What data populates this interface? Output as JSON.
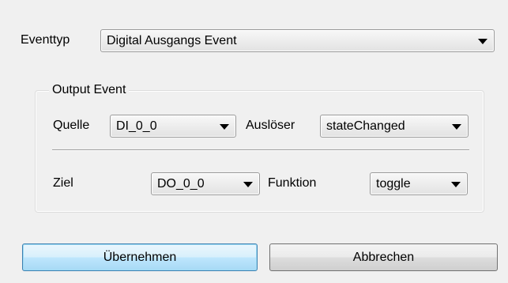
{
  "event_type": {
    "label": "Eventtyp",
    "value": "Digital Ausgangs Event"
  },
  "output_event": {
    "title": "Output Event",
    "source": {
      "label": "Quelle",
      "value": "DI_0_0"
    },
    "trigger": {
      "label": "Auslöser",
      "value": "stateChanged"
    },
    "target": {
      "label": "Ziel",
      "value": "DO_0_0"
    },
    "function": {
      "label": "Funktion",
      "value": "toggle"
    }
  },
  "buttons": {
    "apply": "Übernehmen",
    "cancel": "Abbrechen"
  },
  "colors": {
    "window_background": "#f0f0f0",
    "default_button_border": "#3c7fb1",
    "default_button_fill": "#bee6fd"
  },
  "icons": {
    "dropdown": "chevron-down-icon"
  }
}
